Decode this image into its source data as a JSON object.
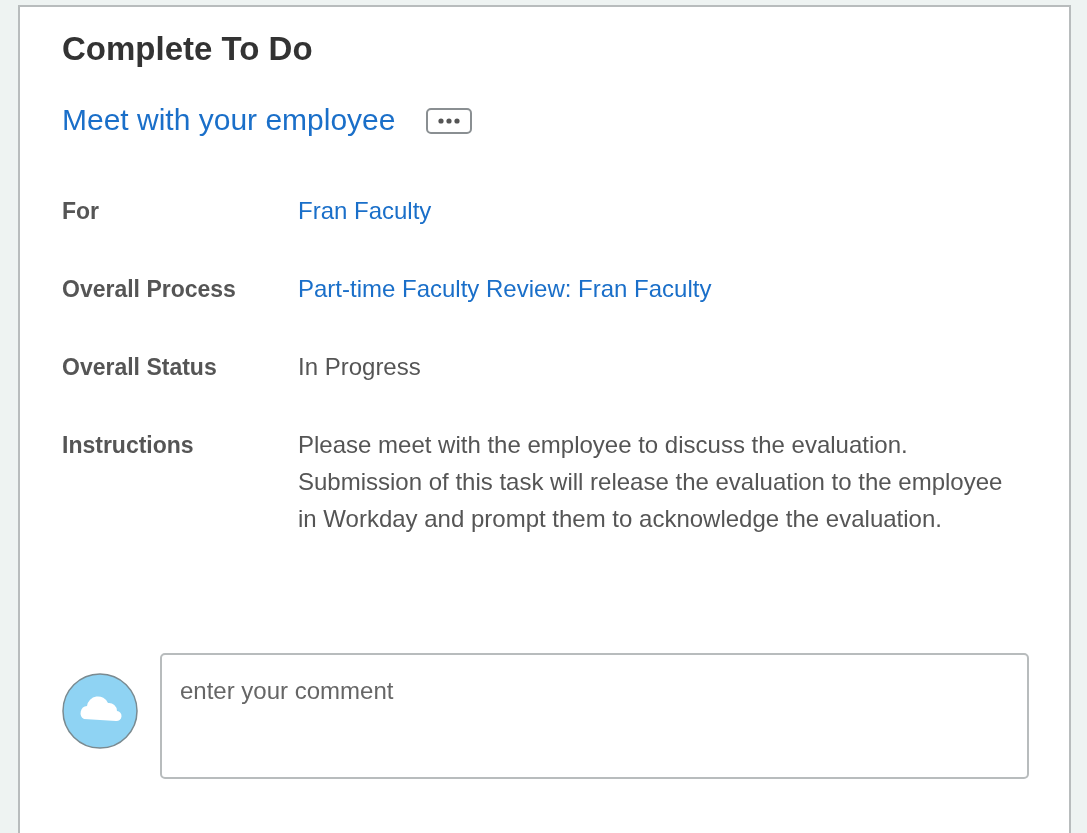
{
  "title": "Complete To Do",
  "task": {
    "link": "Meet with your employee"
  },
  "fields": [
    {
      "label": "For",
      "value": "Fran Faculty",
      "kind": "link"
    },
    {
      "label": "Overall Process",
      "value": "Part-time Faculty Review: Fran Faculty",
      "kind": "link"
    },
    {
      "label": "Overall Status",
      "value": "In Progress",
      "kind": "text"
    },
    {
      "label": "Instructions",
      "value": "Please meet with the employee to discuss the evaluation. Submission of this task will release the evaluation to the employee in Workday and prompt them to acknowledge the evaluation.",
      "kind": "text"
    }
  ],
  "comment": {
    "placeholder": "enter your comment"
  }
}
